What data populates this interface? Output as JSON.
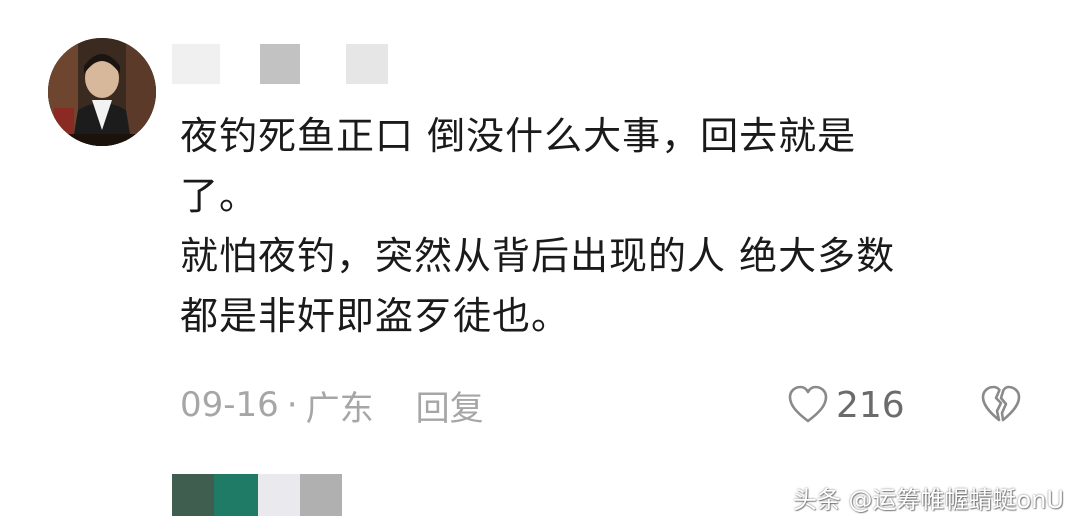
{
  "comment": {
    "lines": [
      "夜钓死鱼正口 倒没什么大事，回去就是",
      "了。",
      "就怕夜钓，突然从背后出现的人 绝大多数",
      "都是非奸即盗歹徒也。"
    ],
    "date": "09-16",
    "separator": "·",
    "location": "广东",
    "reply_label": "回复",
    "like_count": "216",
    "like_icon": "heart-outline-icon",
    "dislike_icon": "broken-heart-icon"
  },
  "username_mosaic_colors": [
    "#f0f0f0",
    "#ffffff",
    "#c2c2c2",
    "#ffffff",
    "#e6e6e6"
  ],
  "bottom_mosaic_colors": [
    "#3f5e50",
    "#1f7a66",
    "#e9e9ee",
    "#b0b0b0"
  ],
  "watermark": "头条 @运筹帷幄蜻蜓onU",
  "colors": {
    "text": "#1a1a1a",
    "meta": "#a6a6a6",
    "icon": "#8a8a8a"
  }
}
